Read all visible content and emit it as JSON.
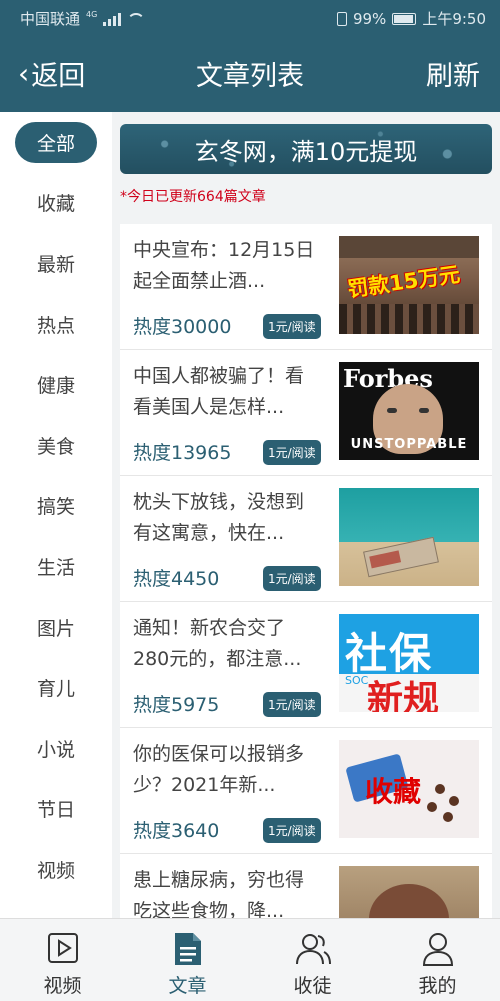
{
  "status_bar": {
    "carrier": "中国联通",
    "network": "4G",
    "battery": "99%",
    "time": "上午9:50"
  },
  "header": {
    "back_label": "返回",
    "title": "文章列表",
    "refresh_label": "刷新"
  },
  "sidebar": {
    "items": [
      {
        "label": "全部",
        "active": true
      },
      {
        "label": "收藏"
      },
      {
        "label": "最新"
      },
      {
        "label": "热点"
      },
      {
        "label": "健康"
      },
      {
        "label": "美食"
      },
      {
        "label": "搞笑"
      },
      {
        "label": "生活"
      },
      {
        "label": "图片"
      },
      {
        "label": "育儿"
      },
      {
        "label": "小说"
      },
      {
        "label": "节日"
      },
      {
        "label": "视频"
      }
    ]
  },
  "banner": {
    "text": "玄冬网，满10元提现"
  },
  "update_note": "*今日已更新664篇文章",
  "articles": [
    {
      "title": "中央宣布：12月15日起全面禁止酒...",
      "hot": "热度30000",
      "price": "1元/阅读",
      "thumb_text": "罚款15万元"
    },
    {
      "title": "中国人都被骗了！看看美国人是怎样...",
      "hot": "热度13965",
      "price": "1元/阅读",
      "thumb_text": "Forbes",
      "thumb_text2": "UNSTOPPABLE"
    },
    {
      "title": "枕头下放钱，没想到有这寓意，快在...",
      "hot": "热度4450",
      "price": "1元/阅读"
    },
    {
      "title": "通知！新农合交了280元的，都注意...",
      "hot": "热度5975",
      "price": "1元/阅读",
      "thumb_text": "社保",
      "thumb_text2": "新规",
      "thumb_text3": "SOC"
    },
    {
      "title": "你的医保可以报销多少？2021年新...",
      "hot": "热度3640",
      "price": "1元/阅读",
      "thumb_text": "收藏"
    },
    {
      "title": "患上糖尿病，穷也得吃这些食物，降...",
      "hot": "",
      "price": ""
    }
  ],
  "bottom_nav": [
    {
      "label": "视频",
      "icon": "video-icon"
    },
    {
      "label": "文章",
      "icon": "article-icon",
      "active": true
    },
    {
      "label": "收徒",
      "icon": "apprentice-icon"
    },
    {
      "label": "我的",
      "icon": "profile-icon"
    }
  ],
  "colors": {
    "primary": "#2b5f72",
    "alert": "#d0021b",
    "background": "#f1f3f4"
  }
}
